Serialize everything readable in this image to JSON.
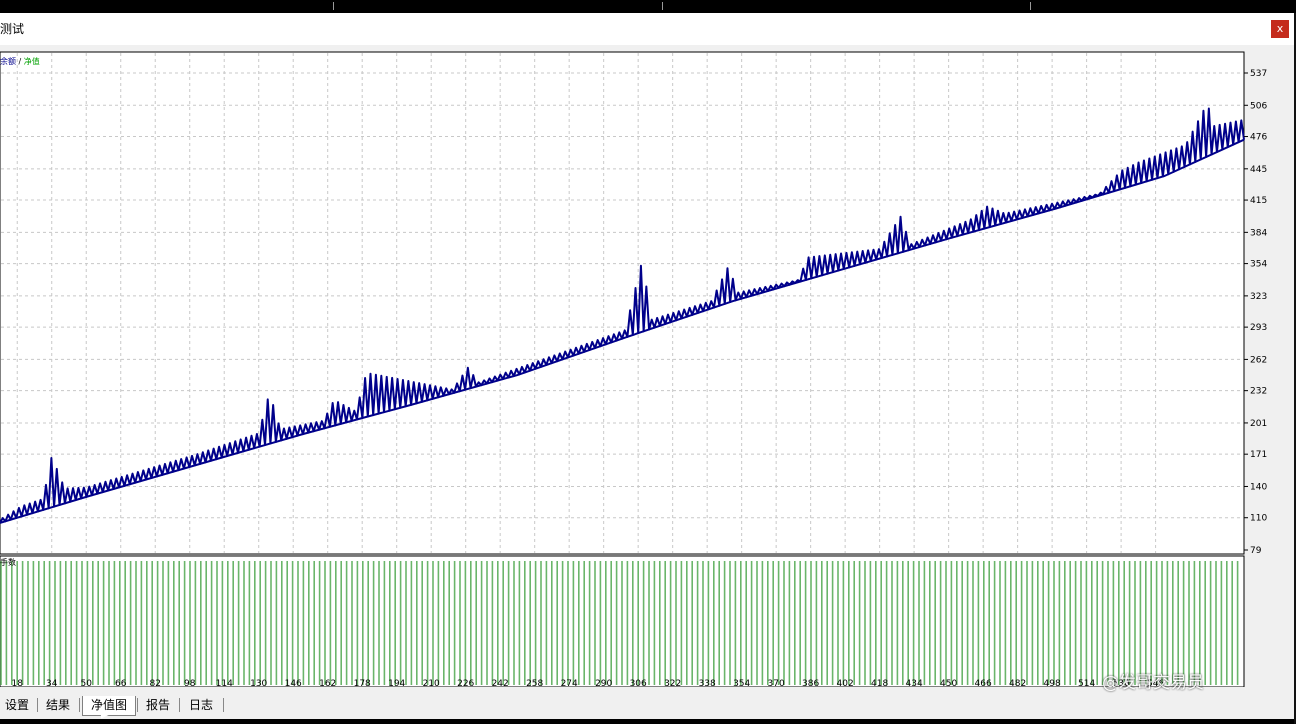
{
  "window": {
    "title": "测试",
    "close_label": "x"
  },
  "chart": {
    "legend_balance": "余额",
    "legend_sep": " / ",
    "legend_equity": "净值",
    "lower_label": "手数",
    "colors": {
      "background": "#ffffff",
      "grid": "#c8c8c8",
      "balance": "#00008b",
      "lots": "#6ab56a",
      "legend_equity": "#00a000"
    }
  },
  "tabs": [
    {
      "label": "设置"
    },
    {
      "label": "结果"
    },
    {
      "label": "净值图"
    },
    {
      "label": "报告"
    },
    {
      "label": "日志"
    }
  ],
  "active_tab": "净值图",
  "watermark": "@发哥交易员",
  "chart_data": {
    "type": "line",
    "y_ticks": [
      537,
      506,
      476,
      445,
      415,
      384,
      354,
      323,
      293,
      262,
      232,
      201,
      171,
      140,
      110,
      79
    ],
    "x_ticks": [
      18,
      34,
      50,
      66,
      82,
      98,
      114,
      130,
      146,
      162,
      178,
      194,
      210,
      226,
      242,
      258,
      274,
      290,
      306,
      322,
      338,
      354,
      370,
      386,
      402,
      418,
      434,
      450,
      466,
      482,
      498,
      514,
      530,
      546
    ],
    "ylim": [
      79,
      537
    ],
    "xlim": [
      10,
      587
    ],
    "grid": true,
    "series": [
      {
        "name": "余额",
        "x": [
          10,
          50,
          100,
          150,
          200,
          250,
          300,
          350,
          400,
          450,
          500,
          550,
          587
        ],
        "y": [
          105,
          130,
          160,
          190,
          218,
          247,
          283,
          318,
          348,
          378,
          407,
          438,
          473
        ]
      },
      {
        "name": "净值",
        "x": [
          10,
          20,
          30,
          34,
          40,
          50,
          100,
          130,
          135,
          140,
          160,
          165,
          175,
          180,
          220,
          227,
          232,
          300,
          308,
          312,
          340,
          348,
          352,
          380,
          385,
          418,
          428,
          432,
          460,
          468,
          476,
          520,
          530,
          538,
          560,
          570,
          573,
          587
        ],
        "y": [
          108,
          121,
          128,
          169,
          138,
          139,
          170,
          191,
          230,
          195,
          203,
          223,
          212,
          249,
          233,
          254,
          240,
          290,
          358,
          300,
          318,
          352,
          326,
          338,
          360,
          368,
          400,
          372,
          396,
          409,
          402,
          421,
          443,
          451,
          468,
          508,
          486,
          492
        ]
      }
    ],
    "lower_panel": {
      "label": "手数",
      "type": "bar",
      "bar_count": 230
    }
  }
}
